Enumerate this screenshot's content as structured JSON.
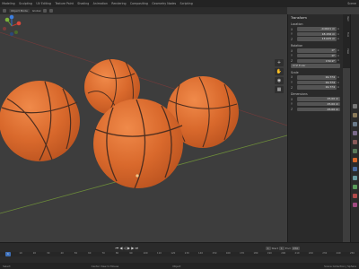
{
  "topbar": {
    "tabs": [
      "Modeling",
      "Sculpting",
      "UV Editing",
      "Texture Paint",
      "Shading",
      "Animation",
      "Rendering",
      "Compositing",
      "Geometry Nodes",
      "Scripting"
    ],
    "scene_label": "Scene"
  },
  "header": {
    "view_label": "Global",
    "mode_label": "Object Mode"
  },
  "npanel": {
    "title": "Transform",
    "location_label": "Location",
    "location": [
      {
        "axis": "X",
        "value": "-0.0021 m"
      },
      {
        "axis": "Y",
        "value": "18.156 m"
      },
      {
        "axis": "Z",
        "value": "13.025 m"
      }
    ],
    "rotation_label": "Rotation",
    "rotation": [
      {
        "axis": "X",
        "value": "0°"
      },
      {
        "axis": "Y",
        "value": "0°"
      },
      {
        "axis": "Z",
        "value": "150.9°"
      }
    ],
    "rotation_mode": "XYZ Euler",
    "scale_label": "Scale",
    "scale": [
      {
        "axis": "X",
        "value": "19.774"
      },
      {
        "axis": "Y",
        "value": "19.774"
      },
      {
        "axis": "Z",
        "value": "19.774"
      }
    ],
    "dimensions_label": "Dimensions",
    "dimensions": [
      {
        "axis": "X",
        "value": "25.00 m"
      },
      {
        "axis": "Y",
        "value": "25.00 m"
      },
      {
        "axis": "Z",
        "value": "25.00 m"
      }
    ],
    "tabs": [
      "Item",
      "Tool",
      "View"
    ]
  },
  "timeline": {
    "start_label": "Start",
    "start": "1",
    "end_label": "End",
    "end": "250",
    "current_frame": "1",
    "ruler_ticks": [
      "0",
      "10",
      "20",
      "30",
      "40",
      "50",
      "60",
      "70",
      "80",
      "90",
      "100",
      "110",
      "120",
      "130",
      "140",
      "150",
      "160",
      "170",
      "180",
      "190",
      "200",
      "210",
      "220",
      "230",
      "240",
      "250"
    ]
  },
  "status": {
    "left": "Select",
    "middle": "Center View to Mouse",
    "right": "Object",
    "info": "Scene Collection | Sphere"
  },
  "colors": {
    "ball": "#d9692c",
    "ball_shadow": "#b9521f",
    "ball_highlight": "#f08a4a",
    "seam": "#4e2e1f",
    "accent": "#3d6fb8"
  }
}
